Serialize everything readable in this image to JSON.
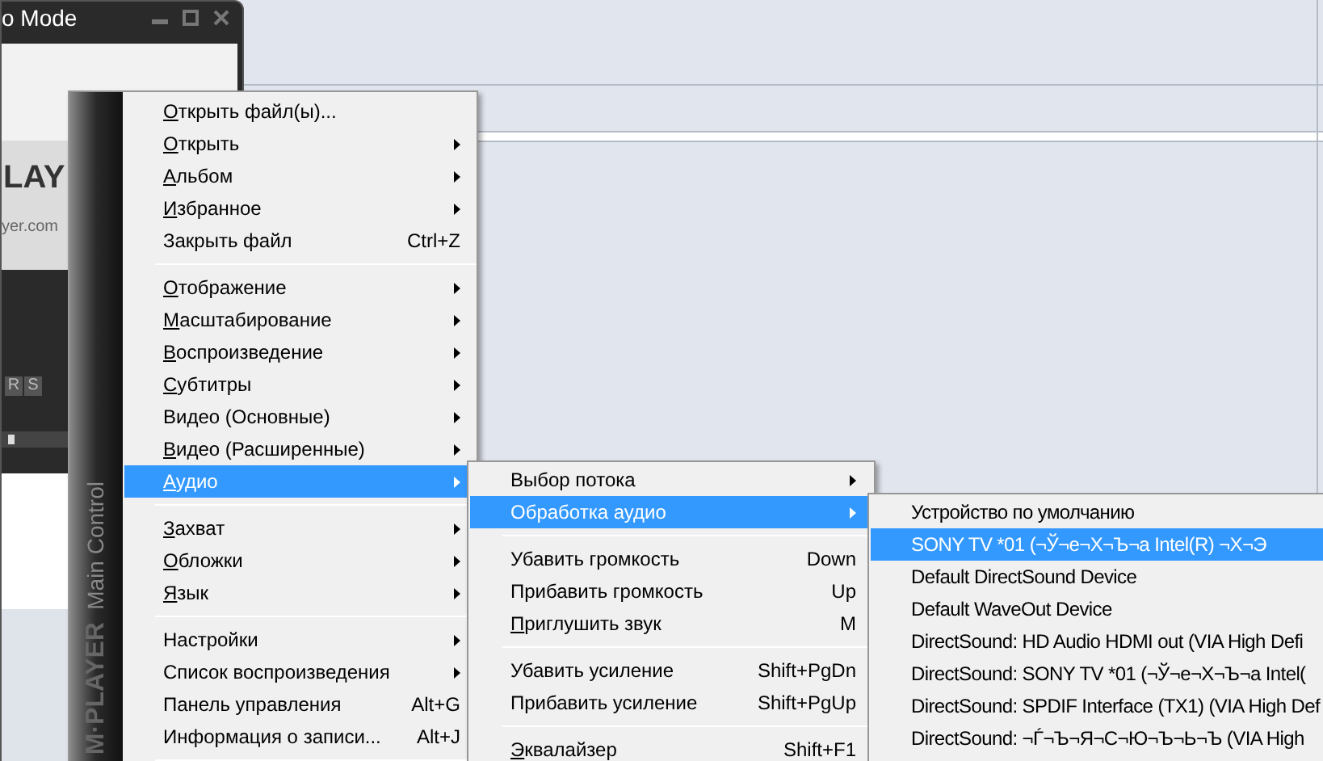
{
  "player_window": {
    "title": "o Mode",
    "logo_text": "LAY",
    "logo_url": "yer.com",
    "buttons": [
      "R",
      "S"
    ]
  },
  "side_strip": {
    "brand": "M·PLAYER",
    "caption": "Main Control"
  },
  "main_menu": [
    {
      "kind": "item",
      "label": "Открыть файл(ы)...",
      "mnemonic": true,
      "submenu": false,
      "selected": false
    },
    {
      "kind": "item",
      "label": "Открыть",
      "mnemonic": true,
      "submenu": true,
      "selected": false
    },
    {
      "kind": "item",
      "label": "Альбом",
      "mnemonic": true,
      "submenu": true,
      "selected": false
    },
    {
      "kind": "item",
      "label": "Избранное",
      "mnemonic": true,
      "submenu": true,
      "selected": false
    },
    {
      "kind": "item",
      "label": "Закрыть файл",
      "shortcut": "Ctrl+Z",
      "mnemonic": false,
      "submenu": false,
      "selected": false
    },
    {
      "kind": "separator"
    },
    {
      "kind": "item",
      "label": "Отображение",
      "mnemonic": true,
      "submenu": true,
      "selected": false
    },
    {
      "kind": "item",
      "label": "Масштабирование",
      "mnemonic": true,
      "submenu": true,
      "selected": false
    },
    {
      "kind": "item",
      "label": "Воспроизведение",
      "mnemonic": true,
      "submenu": true,
      "selected": false
    },
    {
      "kind": "item",
      "label": "Субтитры",
      "mnemonic": true,
      "submenu": true,
      "selected": false
    },
    {
      "kind": "item",
      "label": "Видео (Основные)",
      "mnemonic": false,
      "submenu": true,
      "selected": false
    },
    {
      "kind": "item",
      "label": "Видео (Расширенные)",
      "mnemonic": true,
      "submenu": true,
      "selected": false
    },
    {
      "kind": "item",
      "label": "Аудио",
      "mnemonic": true,
      "submenu": true,
      "selected": true
    },
    {
      "kind": "separator"
    },
    {
      "kind": "item",
      "label": "Захват",
      "mnemonic": true,
      "submenu": true,
      "selected": false
    },
    {
      "kind": "item",
      "label": "Обложки",
      "mnemonic": true,
      "submenu": true,
      "selected": false
    },
    {
      "kind": "item",
      "label": "Язык",
      "mnemonic": true,
      "submenu": true,
      "selected": false
    },
    {
      "kind": "separator"
    },
    {
      "kind": "item",
      "label": "Настройки",
      "mnemonic": false,
      "submenu": true,
      "selected": false
    },
    {
      "kind": "item",
      "label": "Список воспроизведения",
      "mnemonic": false,
      "submenu": true,
      "selected": false
    },
    {
      "kind": "item",
      "label": "Панель управления",
      "shortcut": "Alt+G",
      "mnemonic": false,
      "submenu": false,
      "selected": false
    },
    {
      "kind": "item",
      "label": "Информация о записи...",
      "shortcut": "Alt+J",
      "mnemonic": false,
      "submenu": false,
      "selected": false
    },
    {
      "kind": "separator"
    }
  ],
  "audio_menu": [
    {
      "kind": "item",
      "label": "Выбор потока",
      "mnemonic": false,
      "submenu": true,
      "selected": false
    },
    {
      "kind": "item",
      "label": "Обработка аудио",
      "mnemonic": false,
      "submenu": true,
      "selected": true
    },
    {
      "kind": "separator"
    },
    {
      "kind": "item",
      "label": "Убавить громкость",
      "shortcut": "Down",
      "mnemonic": false,
      "submenu": false,
      "selected": false
    },
    {
      "kind": "item",
      "label": "Прибавить громкость",
      "shortcut": "Up",
      "mnemonic": false,
      "submenu": false,
      "selected": false
    },
    {
      "kind": "item",
      "label": "Приглушить звук",
      "shortcut": "M",
      "mnemonic": true,
      "submenu": false,
      "selected": false
    },
    {
      "kind": "separator"
    },
    {
      "kind": "item",
      "label": "Убавить усиление",
      "shortcut": "Shift+PgDn",
      "mnemonic": false,
      "submenu": false,
      "selected": false
    },
    {
      "kind": "item",
      "label": "Прибавить усиление",
      "shortcut": "Shift+PgUp",
      "mnemonic": false,
      "submenu": false,
      "selected": false
    },
    {
      "kind": "separator"
    },
    {
      "kind": "item",
      "label": "Эквалайзер",
      "shortcut": "Shift+F1",
      "mnemonic": true,
      "submenu": false,
      "selected": false
    }
  ],
  "device_menu": [
    {
      "kind": "item",
      "label": "Устройство по умолчанию",
      "mnemonic": false,
      "selected": false
    },
    {
      "kind": "item",
      "label": "SONY TV  *01 (¬Ў¬е¬Х¬Ъ¬а Intel(R) ¬Х¬Э",
      "mnemonic": false,
      "selected": true
    },
    {
      "kind": "item",
      "label": "Default DirectSound Device",
      "mnemonic": false,
      "selected": false
    },
    {
      "kind": "item",
      "label": "Default WaveOut Device",
      "mnemonic": false,
      "selected": false
    },
    {
      "kind": "item",
      "label": "DirectSound: HD Audio HDMI out (VIA High Defi",
      "mnemonic": false,
      "selected": false
    },
    {
      "kind": "item",
      "label": "DirectSound: SONY TV  *01 (¬Ў¬е¬Х¬Ъ¬а Intel(",
      "mnemonic": false,
      "selected": false
    },
    {
      "kind": "item",
      "label": "DirectSound: SPDIF Interface (TX1) (VIA High Def",
      "mnemonic": false,
      "selected": false
    },
    {
      "kind": "item",
      "label": "DirectSound: ¬Ѓ¬Ъ¬Я¬С¬Ю¬Ъ¬Ь¬Ъ (VIA High",
      "mnemonic": false,
      "selected": false
    }
  ]
}
